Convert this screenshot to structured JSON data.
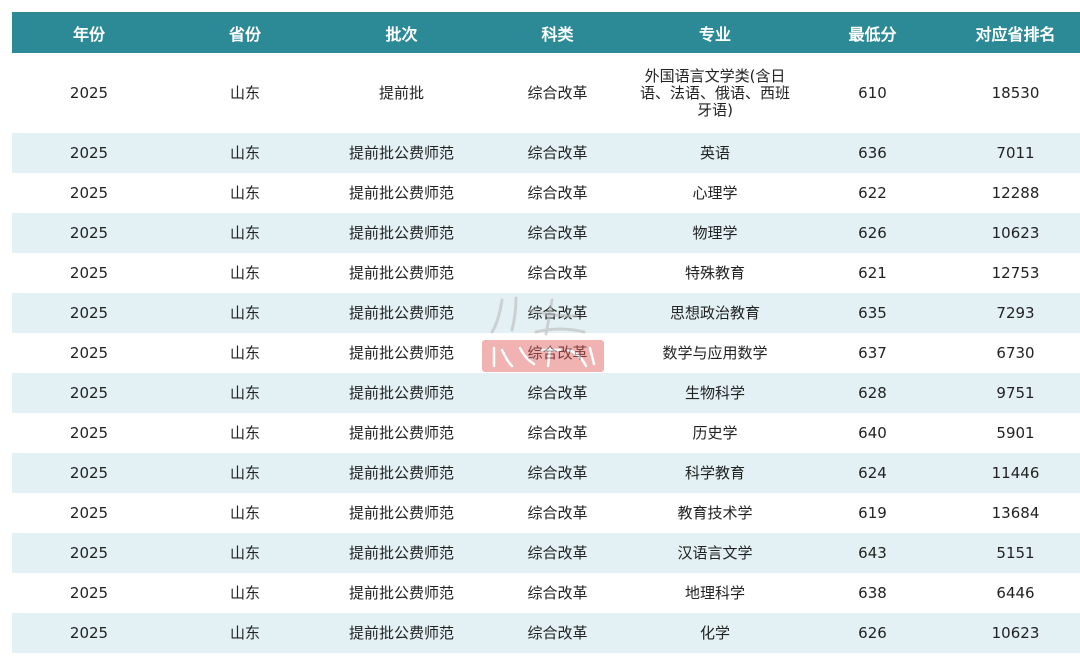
{
  "table": {
    "headers": [
      "年份",
      "省份",
      "批次",
      "科类",
      "专业",
      "最低分",
      "对应省排名"
    ],
    "rows": [
      [
        "2025",
        "山东",
        "提前批",
        "综合改革",
        "外国语言文学类(含日语、法语、俄语、西班牙语)",
        "610",
        "18530"
      ],
      [
        "2025",
        "山东",
        "提前批公费师范",
        "综合改革",
        "英语",
        "636",
        "7011"
      ],
      [
        "2025",
        "山东",
        "提前批公费师范",
        "综合改革",
        "心理学",
        "622",
        "12288"
      ],
      [
        "2025",
        "山东",
        "提前批公费师范",
        "综合改革",
        "物理学",
        "626",
        "10623"
      ],
      [
        "2025",
        "山东",
        "提前批公费师范",
        "综合改革",
        "特殊教育",
        "621",
        "12753"
      ],
      [
        "2025",
        "山东",
        "提前批公费师范",
        "综合改革",
        "思想政治教育",
        "635",
        "7293"
      ],
      [
        "2025",
        "山东",
        "提前批公费师范",
        "综合改革",
        "数学与应用数学",
        "637",
        "6730"
      ],
      [
        "2025",
        "山东",
        "提前批公费师范",
        "综合改革",
        "生物科学",
        "628",
        "9751"
      ],
      [
        "2025",
        "山东",
        "提前批公费师范",
        "综合改革",
        "历史学",
        "640",
        "5901"
      ],
      [
        "2025",
        "山东",
        "提前批公费师范",
        "综合改革",
        "科学教育",
        "624",
        "11446"
      ],
      [
        "2025",
        "山东",
        "提前批公费师范",
        "综合改革",
        "教育技术学",
        "619",
        "13684"
      ],
      [
        "2025",
        "山东",
        "提前批公费师范",
        "综合改革",
        "汉语言文学",
        "643",
        "5151"
      ],
      [
        "2025",
        "山东",
        "提前批公费师范",
        "综合改革",
        "地理科学",
        "638",
        "6446"
      ],
      [
        "2025",
        "山东",
        "提前批公费师范",
        "综合改革",
        "化学",
        "626",
        "10623"
      ]
    ]
  },
  "colors": {
    "header_bg": "#2c8a96",
    "header_text": "#ffffff",
    "stripe_bg": "#e3f1f4",
    "watermark": "#e05a5a"
  },
  "watermark": {
    "text": "山东"
  }
}
